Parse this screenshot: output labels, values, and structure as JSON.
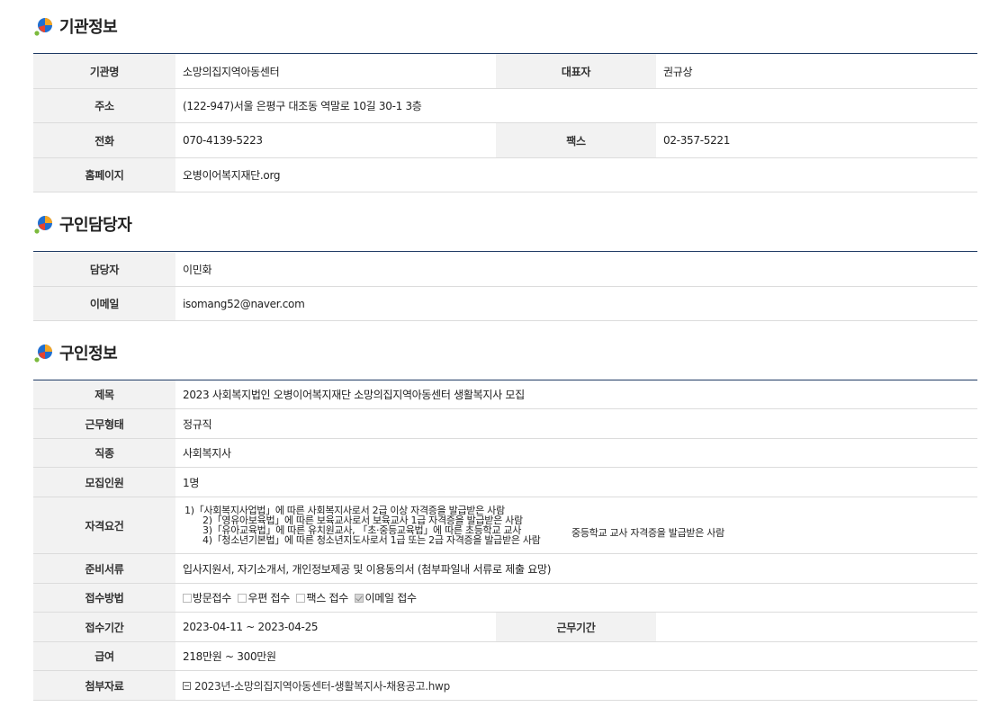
{
  "sections": {
    "org": {
      "title": "기관정보",
      "name_label": "기관명",
      "name": "소망의집지역아동센터",
      "rep_label": "대표자",
      "rep": "권규상",
      "addr_label": "주소",
      "addr": "(122-947)서울 은평구 대조동 역말로 10길 30-1 3층",
      "phone_label": "전화",
      "phone": "070-4139-5223",
      "fax_label": "팩스",
      "fax": "02-357-5221",
      "home_label": "홈페이지",
      "home": "오병이어복지재단.org"
    },
    "contact": {
      "title": "구인담당자",
      "person_label": "담당자",
      "person": "이민화",
      "email_label": "이메일",
      "email": "isomang52@naver.com"
    },
    "job": {
      "title": "구인정보",
      "subject_label": "제목",
      "subject": "2023 사회복지법인 오병이어복지재단 소망의집지역아동센터 생활복지사 모집",
      "type_label": "근무형태",
      "type": "정규직",
      "occupation_label": "직종",
      "occupation": "사회복지사",
      "count_label": "모집인원",
      "count": "1명",
      "req_label": "자격요건",
      "req_lines": [
        "1)「사회복지사업법」에 따른 사회복지사로서 2급 이상 자격증을 발급받은 사람",
        "2)「영유아보육법」에 따른 보육교사로서 보육교사 1급 자격증을 발급받은 사람",
        "3)「유아교육법」에 따른 유치원교사, 「초·중등교육법」에 따른 초등학교 교사",
        "4)「청소년기본법」에 따른 청소년지도사로서 1급 또는 2급 자격증을 발급받은 사람"
      ],
      "req_extra": "중등학교 교사 자격증을 발급받은 사람",
      "docs_label": "준비서류",
      "docs": "입사지원서, 자기소개서, 개인정보제공 및 이용동의서 (첨부파일내 서류로 제출 요망)",
      "method_label": "접수방법",
      "methods": [
        {
          "label": "방문접수",
          "checked": false
        },
        {
          "label": "우편 접수",
          "checked": false
        },
        {
          "label": "팩스 접수",
          "checked": false
        },
        {
          "label": "이메일 접수",
          "checked": true
        }
      ],
      "period_label": "접수기간",
      "period": "2023-04-11 ~ 2023-04-25",
      "work_period_label": "근무기간",
      "work_period": "",
      "salary_label": "급여",
      "salary": "218만원 ~ 300만원",
      "attach_label": "첨부자료",
      "attach": "2023년-소망의집지역아동센터-생활복지사-채용공고.hwp"
    }
  },
  "colors": {
    "table_border_top": "#1e3a64",
    "header_bg": "#f2f2f2",
    "icon_blue": "#1f6fd1",
    "icon_red": "#e8432f",
    "icon_orange": "#f5a623",
    "icon_green": "#7cba3d"
  }
}
